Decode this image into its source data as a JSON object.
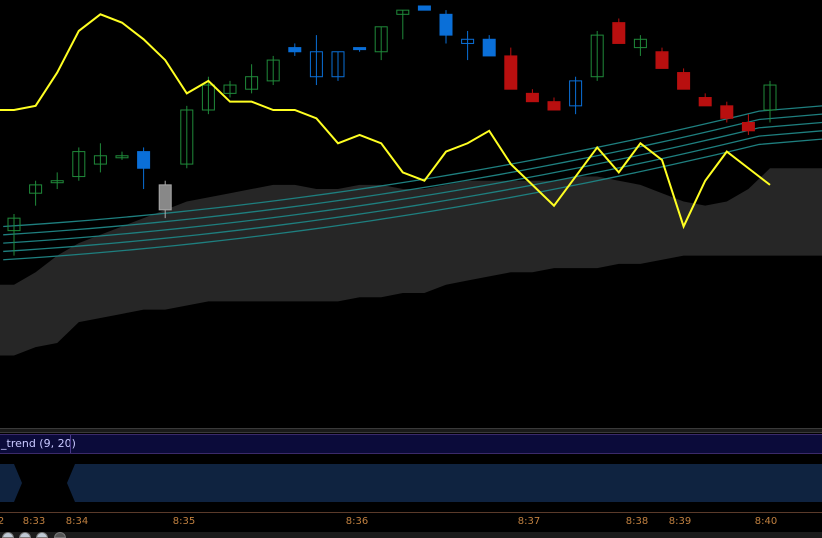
{
  "chart_data": {
    "type": "candlestick",
    "price_range": [
      0,
      100
    ],
    "colors": {
      "background": "#000000",
      "up_candle": "#1f8a3a",
      "down_candle": "#0a6fd8",
      "bear_candle": "#b80f0f",
      "neutral_candle": "#888888",
      "moving_average": "#ffff22",
      "envelope": "#1e7f7f",
      "cloud": "#262626"
    },
    "candles": [
      {
        "o": 46,
        "h": 50,
        "l": 40,
        "c": 49
      },
      {
        "o": 55,
        "h": 58,
        "l": 52,
        "c": 57
      },
      {
        "o": 58,
        "h": 60,
        "l": 56,
        "c": 58
      },
      {
        "o": 59,
        "h": 66,
        "l": 58,
        "c": 65
      },
      {
        "o": 62,
        "h": 67,
        "l": 60,
        "c": 64
      },
      {
        "o": 64,
        "h": 65,
        "l": 63,
        "c": 64
      },
      {
        "o": 65,
        "h": 66,
        "l": 56,
        "c": 61
      },
      {
        "o": 51,
        "h": 58,
        "l": 49,
        "c": 57
      },
      {
        "o": 62,
        "h": 76,
        "l": 61,
        "c": 75
      },
      {
        "o": 75,
        "h": 83,
        "l": 74,
        "c": 81
      },
      {
        "o": 79,
        "h": 82,
        "l": 78,
        "c": 81
      },
      {
        "o": 80,
        "h": 86,
        "l": 79,
        "c": 83
      },
      {
        "o": 82,
        "h": 88,
        "l": 81,
        "c": 87
      },
      {
        "o": 89,
        "h": 91,
        "l": 88,
        "c": 90
      },
      {
        "o": 89,
        "h": 93,
        "l": 81,
        "c": 83
      },
      {
        "o": 83,
        "h": 89,
        "l": 82,
        "c": 89
      },
      {
        "o": 90,
        "h": 90,
        "l": 89,
        "c": 90
      },
      {
        "o": 89,
        "h": 95,
        "l": 87,
        "c": 95
      },
      {
        "o": 98,
        "h": 99,
        "l": 92,
        "c": 99
      },
      {
        "o": 100,
        "h": 100,
        "l": 99,
        "c": 99
      },
      {
        "o": 98,
        "h": 99,
        "l": 91,
        "c": 93
      },
      {
        "o": 92,
        "h": 94,
        "l": 87,
        "c": 91
      },
      {
        "o": 92,
        "h": 93,
        "l": 88,
        "c": 88
      },
      {
        "o": 88,
        "h": 90,
        "l": 80,
        "c": 80
      },
      {
        "o": 79,
        "h": 80,
        "l": 77,
        "c": 77
      },
      {
        "o": 77,
        "h": 78,
        "l": 75,
        "c": 75
      },
      {
        "o": 76,
        "h": 83,
        "l": 74,
        "c": 82
      },
      {
        "o": 83,
        "h": 94,
        "l": 82,
        "c": 93
      },
      {
        "o": 96,
        "h": 97,
        "l": 91,
        "c": 91
      },
      {
        "o": 92,
        "h": 93,
        "l": 88,
        "c": 90
      },
      {
        "o": 89,
        "h": 90,
        "l": 85,
        "c": 85
      },
      {
        "o": 84,
        "h": 85,
        "l": 80,
        "c": 80
      },
      {
        "o": 78,
        "h": 79,
        "l": 76,
        "c": 76
      },
      {
        "o": 76,
        "h": 77,
        "l": 72,
        "c": 73
      },
      {
        "o": 72,
        "h": 74,
        "l": 69,
        "c": 70
      },
      {
        "o": 75,
        "h": 82,
        "l": 72,
        "c": 81
      }
    ],
    "candle_styles": [
      "up",
      "up",
      "up",
      "up",
      "up",
      "up",
      "down",
      "neutral",
      "up",
      "up",
      "up",
      "up",
      "up",
      "down",
      "hollow-down",
      "hollow-down",
      "down",
      "up",
      "up",
      "down",
      "down",
      "hollow-down",
      "down",
      "bear",
      "bear",
      "bear",
      "hollow-down",
      "up",
      "bear",
      "up",
      "bear",
      "bear",
      "bear",
      "bear",
      "bear",
      "up"
    ],
    "moving_average": [
      75,
      76,
      84,
      94,
      98,
      96,
      92,
      87,
      79,
      82,
      77,
      77,
      75,
      75,
      73,
      67,
      69,
      67,
      60,
      58,
      65,
      67,
      70,
      62,
      57,
      52,
      59,
      66,
      60,
      67,
      63,
      47,
      58,
      65,
      61,
      57
    ],
    "envelope_lines": [
      {
        "start": 47,
        "end": 76
      },
      {
        "start": 45,
        "end": 74
      },
      {
        "start": 43,
        "end": 72
      },
      {
        "start": 41,
        "end": 70
      },
      {
        "start": 39,
        "end": 68
      }
    ],
    "cloud_top": [
      33,
      36,
      40,
      43,
      45,
      47,
      49,
      51,
      53,
      54,
      55,
      56,
      57,
      57,
      56,
      56,
      57,
      57,
      56,
      56,
      57,
      58,
      58,
      58,
      58,
      58,
      59,
      59,
      58,
      57,
      55,
      53,
      52,
      53,
      56,
      61
    ],
    "cloud_bottom": [
      16,
      18,
      19,
      24,
      25,
      26,
      27,
      27,
      28,
      29,
      29,
      29,
      29,
      29,
      29,
      29,
      30,
      30,
      31,
      31,
      33,
      34,
      35,
      36,
      36,
      37,
      37,
      37,
      38,
      38,
      39,
      40,
      40,
      40,
      40,
      40
    ]
  },
  "indicator": {
    "name": "_trend (9, 20)"
  },
  "time_axis": {
    "ticks": [
      "2",
      "8:33",
      "8:34",
      "8:35",
      "8:36",
      "8:37",
      "8:38",
      "8:39",
      "8:40"
    ]
  },
  "toolbar": {
    "buttons": [
      "zoom-in-icon",
      "zoom-out-icon",
      "reset-icon",
      "pan-icon"
    ]
  }
}
